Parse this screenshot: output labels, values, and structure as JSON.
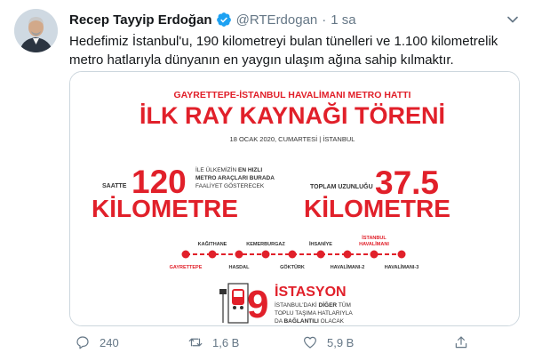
{
  "tweet": {
    "author": {
      "display_name": "Recep Tayyip Erdoğan",
      "handle": "@RTErdogan",
      "time": "1 sa",
      "separator": "·"
    },
    "text": "Hedefimiz İstanbul'u, 190 kilometreyi bulan tünelleri ve 1.100 kilometrelik metro hatlarıyla dünyanın en yaygın ulaşım ağına sahip kılmaktır.",
    "image": {
      "subtitle": "GAYRETTEPE-İSTANBUL HAVALİMANI METRO HATTI",
      "title": "İLK RAY KAYNAĞI TÖRENİ",
      "date": "18 OCAK 2020, CUMARTESİ | İSTANBUL",
      "left_stat": {
        "prefix": "SAATTE",
        "number": "120",
        "note_line1_a": "İLE ÜLKEMİZİN ",
        "note_line1_b": "EN HIZLI",
        "note_line2": "METRO ARAÇLARI BURADA",
        "note_line3": "FAALİYET GÖSTERECEK",
        "unit": "KİLOMETRE"
      },
      "right_stat": {
        "prefix": "TOPLAM UZUNLUĞU",
        "number": "37.5",
        "unit": "KİLOMETRE"
      },
      "stations_top": [
        "KAĞITHANE",
        "KEMERBURGAZ",
        "İHSANİYE",
        "İSTANBUL",
        "HAVALİMANI"
      ],
      "stations_bottom": [
        "GAYRETTEPE",
        "HASDAL",
        "GÖKTÜRK",
        "HAVALİMANI-2",
        "HAVALİMANI-3"
      ],
      "station_count": "9",
      "station_word": "İSTASYON",
      "station_note_1a": "İSTANBUL'DAKİ ",
      "station_note_1b": "DİĞER",
      "station_note_1c": " TÜM",
      "station_note_2": "TOPLU TAŞIMA HATLARIYLA",
      "station_note_3a": "DA ",
      "station_note_3b": "BAĞLANTILI",
      "station_note_3c": " OLACAK"
    },
    "actions": {
      "replies": "240",
      "retweets": "1,6 B",
      "likes": "5,9 B"
    }
  },
  "colors": {
    "accent_red": "#e1202a",
    "dark_gray": "#333333",
    "verified_blue": "#1da1f2",
    "secondary_text": "#657786"
  },
  "icons": [
    "verified-badge-icon",
    "chevron-down-icon",
    "reply-icon",
    "retweet-icon",
    "like-icon",
    "share-icon",
    "bus-stop-icon"
  ]
}
